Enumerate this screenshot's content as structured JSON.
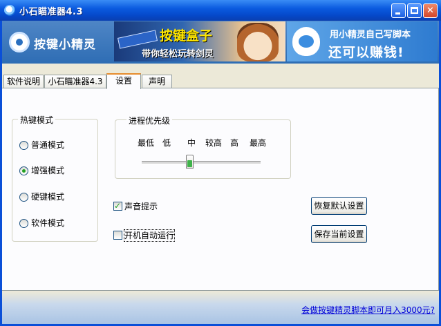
{
  "window": {
    "title": "小石瞄准器4.3"
  },
  "banner": {
    "brand": "按键小精灵",
    "ad1_title": "按键盒子",
    "ad1_subtitle": "带你轻松玩转剑灵",
    "ad2_line1": "用小精灵自己写脚本",
    "ad2_line2": "还可以赚钱!"
  },
  "tabs": [
    "软件说明",
    "小石瞄准器4.3",
    "设置",
    "声明"
  ],
  "active_tab": "设置",
  "hotkey_group": {
    "label": "热键模式",
    "options": [
      "普通模式",
      "增强模式",
      "硬键模式",
      "软件模式"
    ],
    "selected": "增强模式"
  },
  "priority_group": {
    "label": "进程优先级",
    "ticks": [
      "最低",
      "低",
      "中",
      "较高",
      "高",
      "最高"
    ],
    "selected": "中"
  },
  "options": {
    "sound_label": "声音提示",
    "sound_checked": true,
    "autostart_label": "开机自动运行",
    "autostart_checked": false
  },
  "buttons": {
    "restore_defaults": "恢复默认设置",
    "save_current": "保存当前设置"
  },
  "footer": {
    "link_text": "会做按键精灵脚本即可月入3000元?"
  }
}
